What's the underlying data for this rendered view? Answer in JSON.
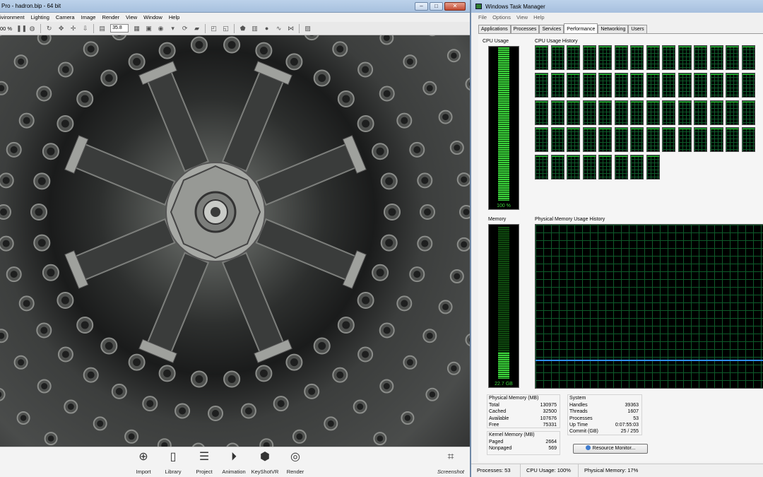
{
  "keyshot": {
    "title": "Pro - hadron.bip - 64 bit",
    "menu": [
      "ivironment",
      "Lighting",
      "Camera",
      "Image",
      "Render",
      "View",
      "Window",
      "Help"
    ],
    "toolbar": {
      "zoom": "00 %",
      "focal_length": "35.8"
    },
    "dock": [
      {
        "label": "Import",
        "icon": "import-icon"
      },
      {
        "label": "Library",
        "icon": "library-icon"
      },
      {
        "label": "Project",
        "icon": "project-icon"
      },
      {
        "label": "Animation",
        "icon": "animation-icon"
      },
      {
        "label": "KeyShotVR",
        "icon": "keyshotvr-icon"
      },
      {
        "label": "Render",
        "icon": "render-icon"
      }
    ],
    "screenshot_label": "Screenshot"
  },
  "taskmgr": {
    "title": "Windows Task Manager",
    "menu": [
      "File",
      "Options",
      "View",
      "Help"
    ],
    "tabs": [
      "Applications",
      "Processes",
      "Services",
      "Performance",
      "Networking",
      "Users"
    ],
    "active_tab": "Performance",
    "cpu_usage_label": "CPU Usage",
    "cpu_usage_value": "100 %",
    "cpu_usage_fraction": 1.0,
    "cpu_history_label": "CPU Usage History",
    "cpu_cores": 64,
    "memory_label": "Memory",
    "memory_value": "22.7 GB",
    "memory_fraction": 0.17,
    "memory_history_label": "Physical Memory Usage History",
    "physical_memory": {
      "header": "Physical Memory (MB)",
      "rows": [
        {
          "label": "Total",
          "value": "130975"
        },
        {
          "label": "Cached",
          "value": "32500"
        },
        {
          "label": "Available",
          "value": "107676"
        },
        {
          "label": "Free",
          "value": "75331"
        }
      ]
    },
    "kernel_memory": {
      "header": "Kernel Memory (MB)",
      "rows": [
        {
          "label": "Paged",
          "value": "2664"
        },
        {
          "label": "Nonpaged",
          "value": "569"
        }
      ]
    },
    "system": {
      "header": "System",
      "rows": [
        {
          "label": "Handles",
          "value": "39363"
        },
        {
          "label": "Threads",
          "value": "1607"
        },
        {
          "label": "Processes",
          "value": "53"
        },
        {
          "label": "Up Time",
          "value": "0:07:55:03"
        },
        {
          "label": "Commit (GB)",
          "value": "25 / 255"
        }
      ]
    },
    "resource_monitor_label": "Resource Monitor...",
    "status": {
      "processes": "Processes: 53",
      "cpu": "CPU Usage: 100%",
      "memory": "Physical Memory: 17%"
    }
  },
  "colors": {
    "meter_green": "#3bd33b",
    "memory_line_blue": "#2f8cf0",
    "titlebar": "#bcd2ea"
  }
}
